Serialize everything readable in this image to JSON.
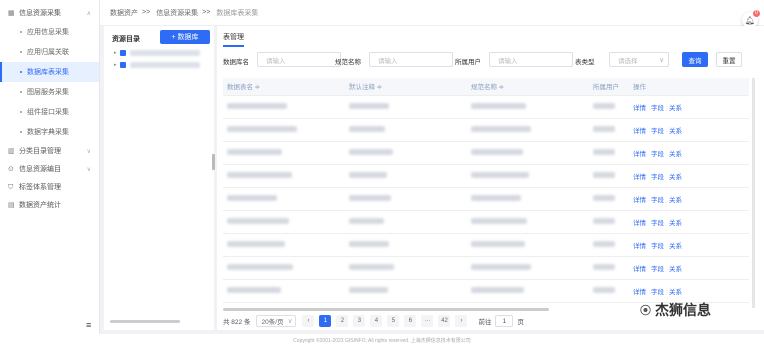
{
  "sidebar": {
    "groups": [
      {
        "label": "信息资源采集",
        "icon": "grid-icon"
      },
      {
        "label": "分类目录管理",
        "icon": "chart-icon"
      },
      {
        "label": "信息资源编目",
        "icon": "lock-icon"
      },
      {
        "label": "标签体系管理",
        "icon": "tag-icon"
      },
      {
        "label": "数据资产统计",
        "icon": "bar-chart-icon"
      }
    ],
    "items": [
      {
        "label": "应用信息采集"
      },
      {
        "label": "应用归属关联"
      },
      {
        "label": "数据库表采集"
      },
      {
        "label": "图层服务采集"
      },
      {
        "label": "组件接口采集"
      },
      {
        "label": "数据字典采集"
      }
    ]
  },
  "breadcrumb": [
    "数据资产",
    "信息资源采集",
    "数据库表采集"
  ],
  "breadcrumb_sep": ">>",
  "notifications": {
    "badge": "0"
  },
  "tree": {
    "title": "资源目录",
    "add_label": "+ 数据库"
  },
  "main": {
    "tab": "表管理",
    "filters": {
      "db_label": "数据库名",
      "db_placeholder": "请输入",
      "std_label": "规范名称",
      "std_placeholder": "请输入",
      "owner_label": "所属用户",
      "owner_placeholder": "请输入",
      "type_label": "表类型",
      "type_placeholder": "请选择",
      "query": "查询",
      "reset": "重置"
    },
    "columns": [
      "数据表名 ≑",
      "默认注释 ≑",
      "规范名称 ≑",
      "所属用户",
      "操作"
    ],
    "actions": [
      "详情",
      "字段",
      "关系"
    ],
    "row_count": 9
  },
  "pagination": {
    "total": "共 822 条",
    "size": "20条/页",
    "pages": [
      "1",
      "2",
      "3",
      "4",
      "5",
      "6",
      "···",
      "42"
    ],
    "goto": "前往",
    "goto_value": "1",
    "goto_suffix": "页"
  },
  "watermark": "杰狮信息",
  "footer": "Copyright ©2001-2023 GISINFO, All rights reserved. 上海杰狮信息技术有限公司",
  "colors": {
    "accent": "#2f6cf6",
    "badge": "#f56c6c"
  }
}
